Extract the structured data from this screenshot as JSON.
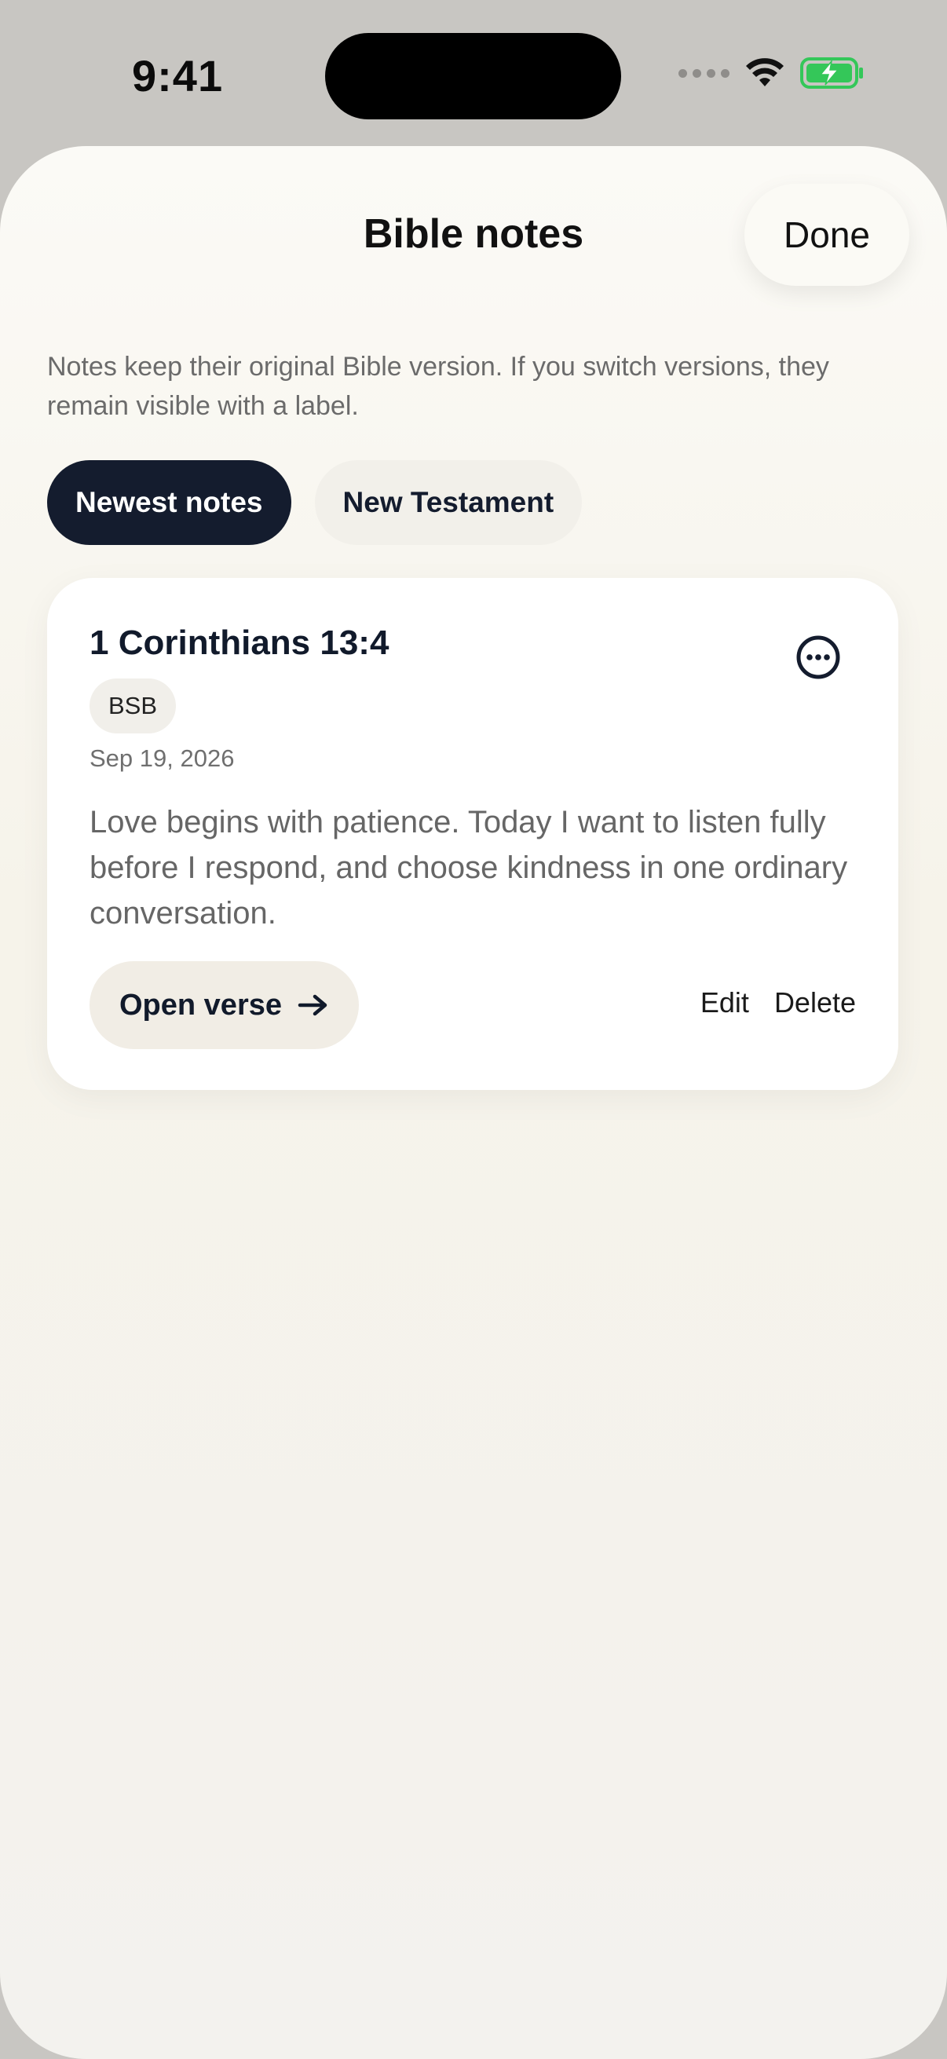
{
  "status_bar": {
    "time": "9:41"
  },
  "sheet": {
    "title": "Bible notes",
    "done_label": "Done",
    "intro": "Notes keep their original Bible version. If you switch versions, they remain visible with a label."
  },
  "filters": [
    {
      "label": "Newest notes",
      "selected": true
    },
    {
      "label": "New Testament",
      "selected": false
    }
  ],
  "note": {
    "reference": "1 Corinthians 13:4",
    "version": "BSB",
    "date": "Sep 19, 2026",
    "body": "Love begins with patience. Today I want to listen fully before I respond, and choose kindness in one ordinary conversation.",
    "open_label": "Open verse",
    "edit_label": "Edit",
    "delete_label": "Delete"
  },
  "icons": {
    "more": "ellipsis-circle-icon",
    "arrow": "arrow-right-icon",
    "wifi": "wifi-icon",
    "battery": "battery-charging-icon",
    "signal": "signal-dots-icon"
  },
  "colors": {
    "primary_dark": "#141c2e",
    "battery_green": "#34c759"
  }
}
